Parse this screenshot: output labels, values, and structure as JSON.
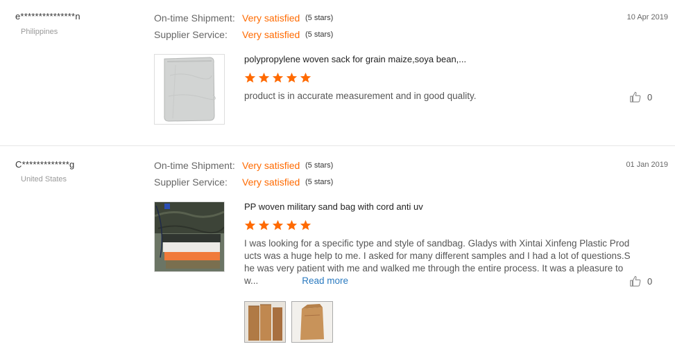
{
  "reviews": [
    {
      "user": "e***************n",
      "country": "Philippines",
      "date": "10 Apr 2019",
      "shipment_label": "On-time Shipment:",
      "shipment_value": "Very satisfied",
      "shipment_stars": "(5 stars)",
      "service_label": "Supplier Service:",
      "service_value": "Very satisfied",
      "service_stars": "(5 stars)",
      "product_title": "polypropylene woven sack for grain maize,soya bean,...",
      "rating": 5,
      "text": "product is in accurate measurement and in good quality.",
      "likes": "0"
    },
    {
      "user": "C*************g",
      "country": "United States",
      "date": "01 Jan 2019",
      "shipment_label": "On-time Shipment:",
      "shipment_value": "Very satisfied",
      "shipment_stars": "(5 stars)",
      "service_label": "Supplier Service:",
      "service_value": "Very satisfied",
      "service_stars": "(5 stars)",
      "product_title": "PP woven military sand bag with cord anti uv",
      "rating": 5,
      "text": "I was looking for a specific type and style of sandbag. Gladys with Xintai Xinfeng Plastic Products was a huge help to me. I asked for many different samples and I had a lot of questions.She was very patient with me and walked me through the entire process. It was a pleasure to w...",
      "read_more": "Read more",
      "likes": "0"
    }
  ],
  "colors": {
    "accent": "#ff6a00",
    "link": "#2a7ac0",
    "divider": "#e6e6e6"
  },
  "icons": {
    "star": "star-icon",
    "like": "thumbs-up-icon"
  }
}
